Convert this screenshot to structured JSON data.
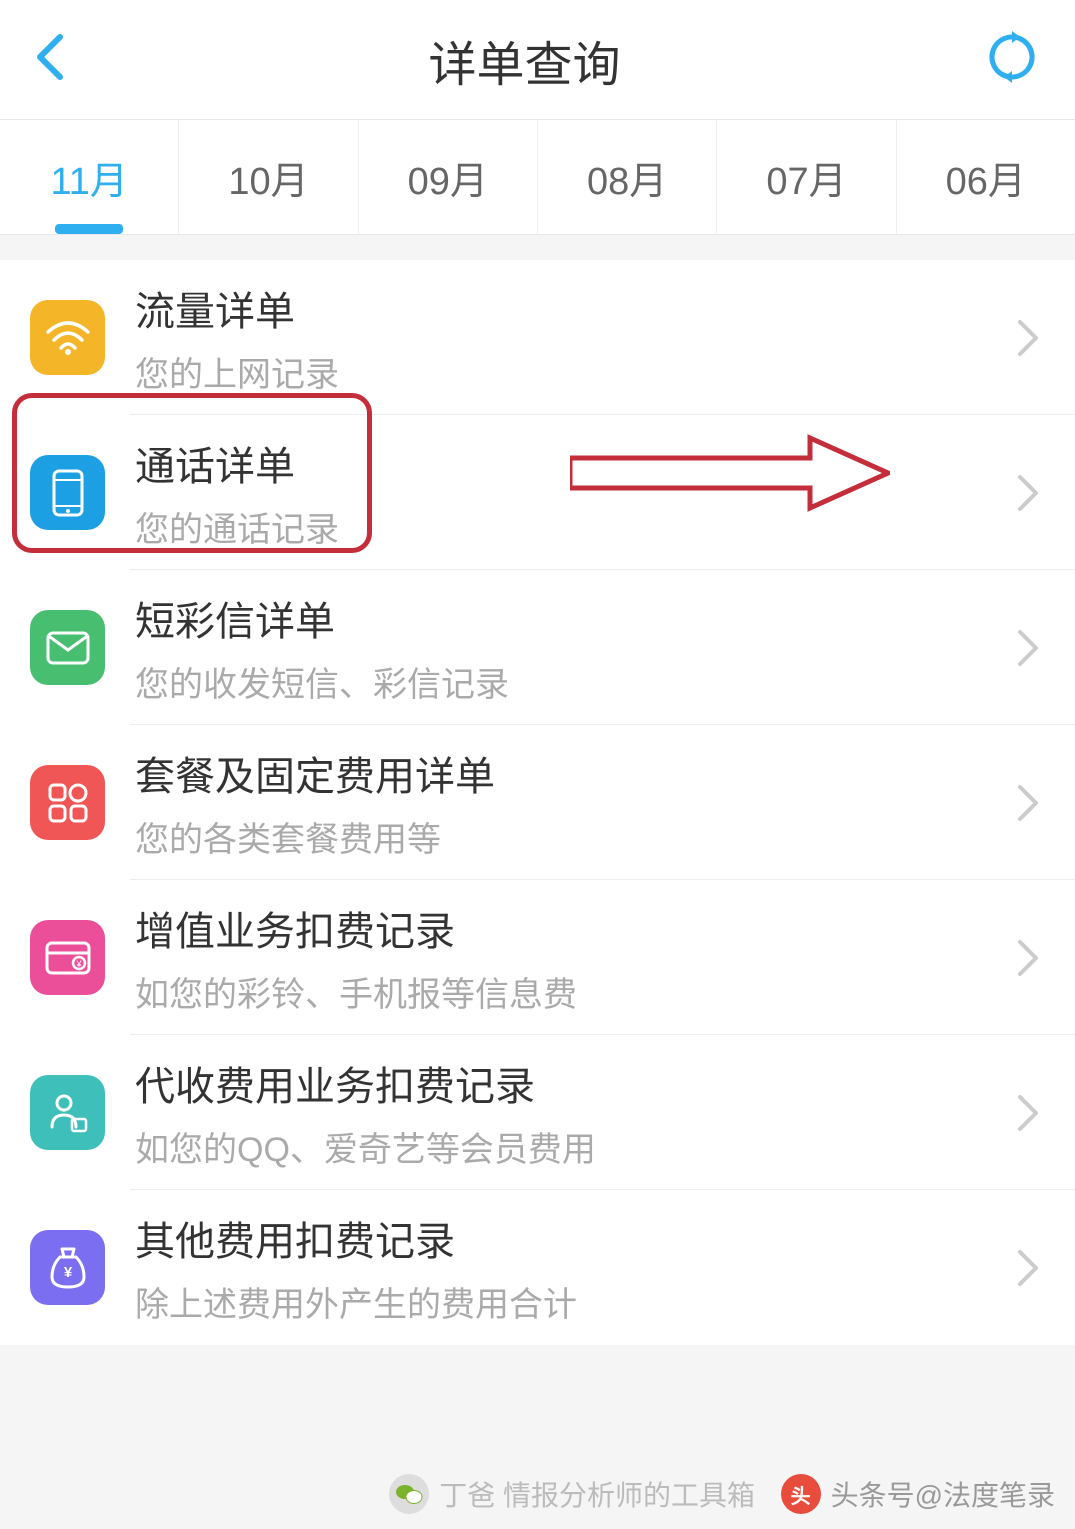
{
  "header": {
    "title": "详单查询"
  },
  "tabs": [
    {
      "label": "11月",
      "active": true
    },
    {
      "label": "10月",
      "active": false
    },
    {
      "label": "09月",
      "active": false
    },
    {
      "label": "08月",
      "active": false
    },
    {
      "label": "07月",
      "active": false
    },
    {
      "label": "06月",
      "active": false
    }
  ],
  "items": [
    {
      "icon": "wifi",
      "title": "流量详单",
      "subtitle": "您的上网记录",
      "color": "bg-wifi"
    },
    {
      "icon": "phone",
      "title": "通话详单",
      "subtitle": "您的通话记录",
      "color": "bg-phone"
    },
    {
      "icon": "mail",
      "title": "短彩信详单",
      "subtitle": "您的收发短信、彩信记录",
      "color": "bg-mail"
    },
    {
      "icon": "package",
      "title": "套餐及固定费用详单",
      "subtitle": "您的各类套餐费用等",
      "color": "bg-package"
    },
    {
      "icon": "value",
      "title": "增值业务扣费记录",
      "subtitle": "如您的彩铃、手机报等信息费",
      "color": "bg-value"
    },
    {
      "icon": "collect",
      "title": "代收费用业务扣费记录",
      "subtitle": "如您的QQ、爱奇艺等会员费用",
      "color": "bg-collect"
    },
    {
      "icon": "other",
      "title": "其他费用扣费记录",
      "subtitle": "除上述费用外产生的费用合计",
      "color": "bg-other"
    }
  ],
  "watermark1": "头条号@法度笔录",
  "watermark2": "丁爸 情报分析师的工具箱"
}
